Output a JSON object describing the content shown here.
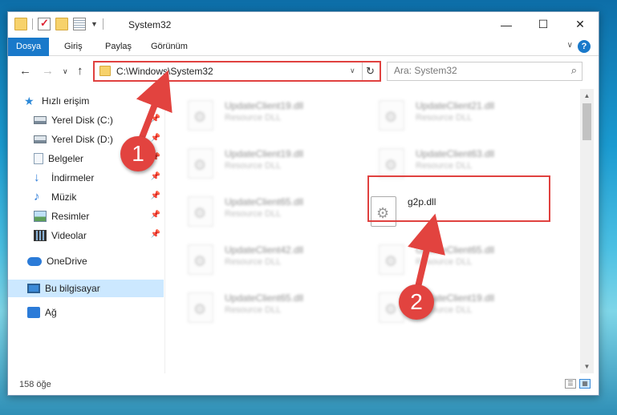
{
  "window": {
    "title": "System32",
    "controls": {
      "minimize": "—",
      "maximize": "☐",
      "close": "✕"
    }
  },
  "ribbon": {
    "tabs": [
      "Dosya",
      "Giriş",
      "Paylaş",
      "Görünüm"
    ],
    "help": "?",
    "expand": "∨"
  },
  "nav": {
    "back": "←",
    "forward": "→",
    "recent": "∨",
    "up": "↑",
    "address": "C:\\Windows\\System32",
    "address_dropdown": "∨",
    "refresh": "↻",
    "search_placeholder": "Ara: System32",
    "search_icon": "⌕"
  },
  "sidebar": {
    "items": [
      {
        "label": "Hızlı erişim",
        "icon": "star-icon",
        "pinned": false
      },
      {
        "label": "Yerel Disk (C:)",
        "icon": "drive-icon",
        "pinned": true
      },
      {
        "label": "Yerel Disk (D:)",
        "icon": "drive-icon",
        "pinned": true
      },
      {
        "label": "Belgeler",
        "icon": "document-icon",
        "pinned": true
      },
      {
        "label": "İndirmeler",
        "icon": "download-icon",
        "pinned": true
      },
      {
        "label": "Müzik",
        "icon": "music-icon",
        "pinned": true
      },
      {
        "label": "Resimler",
        "icon": "pictures-icon",
        "pinned": true
      },
      {
        "label": "Videolar",
        "icon": "video-icon",
        "pinned": true
      },
      {
        "label": "OneDrive",
        "icon": "cloud-icon",
        "pinned": false
      },
      {
        "label": "Bu bilgisayar",
        "icon": "computer-icon",
        "pinned": false,
        "selected": true
      },
      {
        "label": "Ağ",
        "icon": "network-icon",
        "pinned": false
      }
    ],
    "pin_glyph": "📌"
  },
  "files": [
    {
      "name": "UpdateClient19.dll",
      "desc": "Resource DLL"
    },
    {
      "name": "UpdateClient21.dll",
      "desc": "Resource DLL"
    },
    {
      "name": "UpdateClient19.dll",
      "desc": "Resource DLL"
    },
    {
      "name": "UpdateClient63.dll",
      "desc": "Resource DLL"
    },
    {
      "name": "UpdateClient65.dll",
      "desc": "Resource DLL"
    },
    {
      "name": "g2p.dll",
      "desc": ""
    },
    {
      "name": "UpdateClient42.dll",
      "desc": "Resource DLL"
    },
    {
      "name": "UpdateClient65.dll",
      "desc": "Resource DLL"
    },
    {
      "name": "UpdateClient65.dll",
      "desc": "Resource DLL"
    },
    {
      "name": "UpdateClient19.dll",
      "desc": "Resource DLL"
    }
  ],
  "status": {
    "count": "158 öğe",
    "view_details": "☰",
    "view_icons": "▦"
  },
  "annotations": {
    "step1": "1",
    "step2": "2",
    "color": "#e2433f"
  }
}
